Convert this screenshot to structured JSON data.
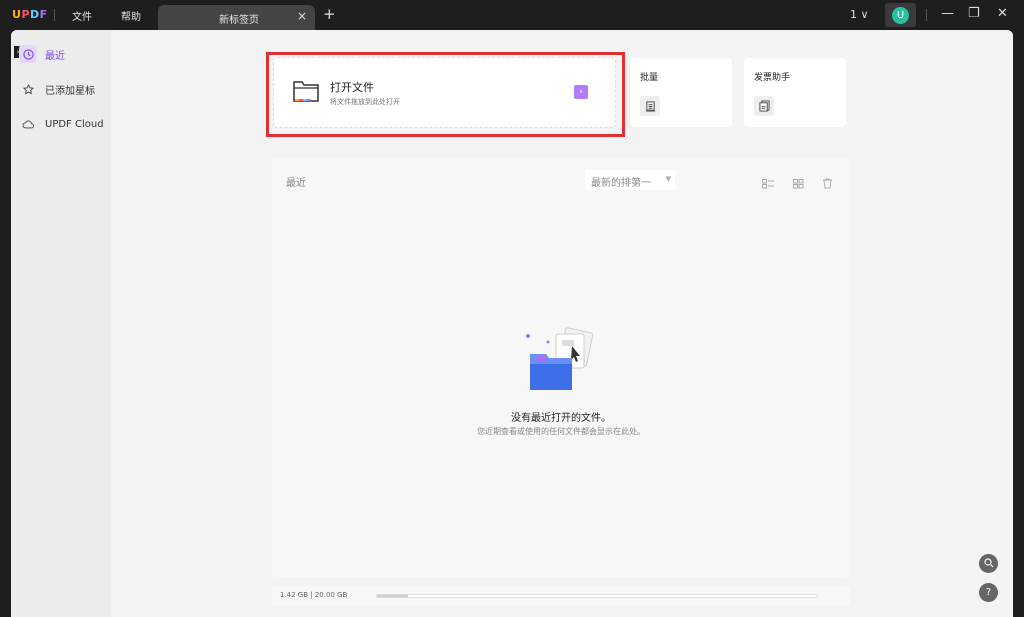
{
  "app": {
    "logo_parts": [
      "U",
      "P",
      "D",
      "F"
    ],
    "menu": {
      "file": "文件",
      "help": "帮助"
    },
    "tab_label": "新标签页",
    "tab_close": "×",
    "new_tab": "+",
    "page_count": "1 ∨",
    "avatar_letter": "U",
    "window_controls": {
      "minimize": "—",
      "restore": "❐",
      "close": "✕"
    }
  },
  "sidebar": {
    "items": [
      {
        "label": "最近",
        "icon": "clock-icon",
        "active": true
      },
      {
        "label": "已添加星标",
        "icon": "star-icon",
        "active": false
      },
      {
        "label": "UPDF Cloud",
        "icon": "cloud-icon",
        "active": false
      }
    ]
  },
  "open_file": {
    "title": "打开文件",
    "subtitle": "将文件拖放到此处打开",
    "arrow": "›"
  },
  "batch": {
    "title": "批量"
  },
  "invoice": {
    "title": "发票助手"
  },
  "recent": {
    "heading": "最近",
    "sort_value": "最新的排第一",
    "empty_title": "没有最近打开的文件。",
    "empty_subtitle": "您近期查看或使用的任何文件都会显示在此处。"
  },
  "storage": {
    "text": "1.42 GB | 20.00 GB",
    "used_fraction": 0.071
  },
  "colors": {
    "accent": "#7b4be6",
    "highlight": "#e03030",
    "arrow": "#b57bff"
  }
}
